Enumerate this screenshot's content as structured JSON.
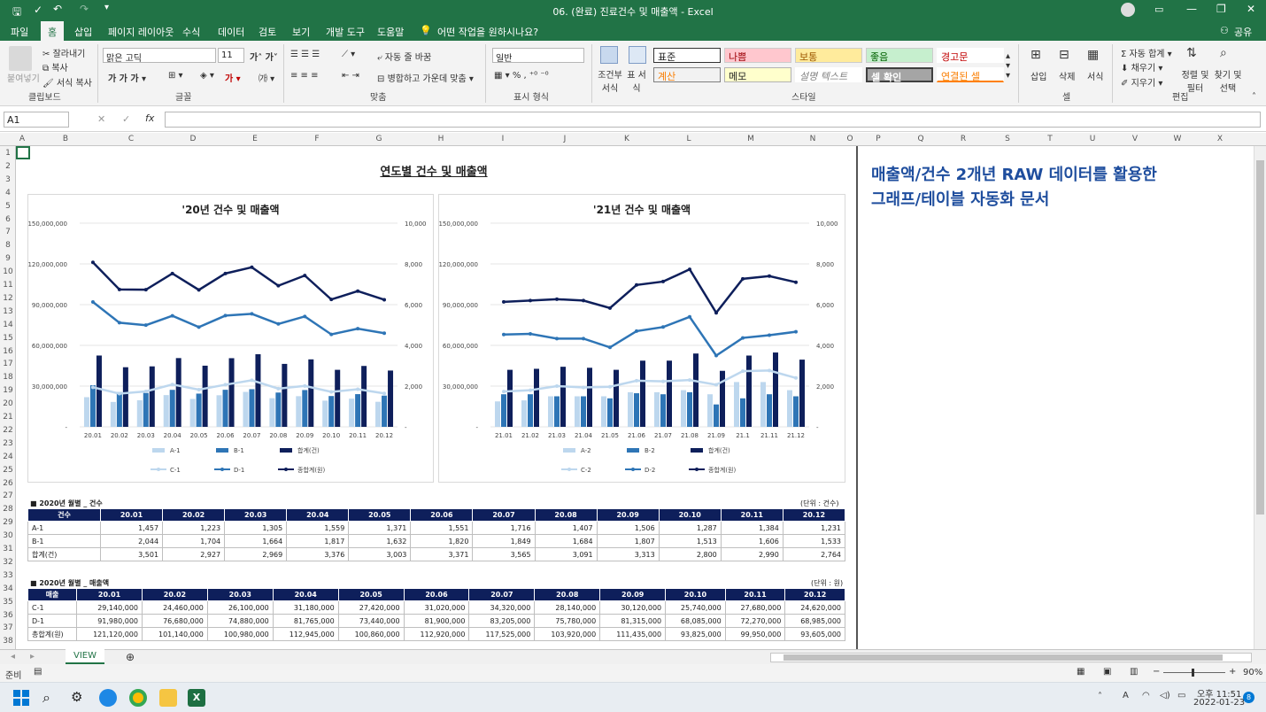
{
  "window": {
    "title": "06. (완료) 진료건수 및 매출액  -  Excel"
  },
  "menu": [
    "파일",
    "홈",
    "삽입",
    "페이지 레이아웃",
    "수식",
    "데이터",
    "검토",
    "보기",
    "개발 도구",
    "도움말"
  ],
  "menu_search": "어떤 작업을 원하시나요?",
  "share_label": "공유",
  "ribbon": {
    "paste": "붙여넣기",
    "cut": "잘라내기",
    "copy": "복사",
    "format_painter": "서식 복사",
    "clipboard": "클립보드",
    "font_name": "맑은 고딕",
    "font_size": "11",
    "font_group": "글꼴",
    "wrap_text": "자동 줄 바꿈",
    "merge_center": "병합하고 가운데 맞춤",
    "align_group": "맞춤",
    "number_format": "일반",
    "number_group": "표시 형식",
    "cond_format": "조건부 서식",
    "table_format": "표 서식",
    "styles": [
      "표준",
      "나쁨",
      "보통",
      "좋음",
      "경고문",
      "계산",
      "메모",
      "설명 텍스트",
      "셀 확인",
      "연결된 셀"
    ],
    "style_group": "스타일",
    "insert": "삽입",
    "delete": "삭제",
    "format": "서식",
    "cells_group": "셀",
    "autosum": "자동 합계",
    "fill": "채우기",
    "clear": "지우기",
    "sort_filter": "정렬 및 필터",
    "find_select": "찾기 및 선택",
    "edit_group": "편집"
  },
  "name_box": "A1",
  "columns": [
    "A",
    "B",
    "C",
    "D",
    "E",
    "F",
    "G",
    "H",
    "I",
    "J",
    "K",
    "L",
    "M",
    "N",
    "O",
    "P",
    "Q",
    "R",
    "S",
    "T",
    "U",
    "V",
    "W",
    "X"
  ],
  "rows": [
    "1",
    "2",
    "3",
    "4",
    "5",
    "6",
    "7",
    "8",
    "9",
    "10",
    "11",
    "12",
    "13",
    "14",
    "15",
    "16",
    "17",
    "18",
    "19",
    "20",
    "21",
    "22",
    "23",
    "24",
    "25",
    "26",
    "27",
    "28",
    "29",
    "30",
    "31",
    "32",
    "33",
    "34",
    "35",
    "36",
    "37",
    "38"
  ],
  "sheet": {
    "main_title": "연도별 건수 및 매출액",
    "side_title_line1": "매출액/건수 2개년 RAW 데이터를 활용한",
    "side_title_line2": "그래프/테이블 자동화 문서"
  },
  "chart_data": [
    {
      "type": "bar",
      "title": "'20년 건수 및 매출액",
      "categories": [
        "20.01",
        "20.02",
        "20.03",
        "20.04",
        "20.05",
        "20.06",
        "20.07",
        "20.08",
        "20.09",
        "20.10",
        "20.11",
        "20.12"
      ],
      "y_left_ticks": [
        "150,000,000",
        "120,000,000",
        "90,000,000",
        "60,000,000",
        "30,000,000",
        "-"
      ],
      "y_right_ticks": [
        "10,000",
        "8,000",
        "6,000",
        "4,000",
        "2,000",
        "-"
      ],
      "ylim_left": [
        0,
        150000000
      ],
      "ylim_right": [
        0,
        10000
      ],
      "series": [
        {
          "name": "A-1",
          "kind": "bar",
          "axis": "right",
          "color": "#bdd7ee",
          "values": [
            1457,
            1223,
            1305,
            1559,
            1371,
            1551,
            1716,
            1407,
            1506,
            1287,
            1384,
            1231
          ]
        },
        {
          "name": "B-1",
          "kind": "bar",
          "axis": "right",
          "color": "#2e75b6",
          "values": [
            2044,
            1704,
            1664,
            1817,
            1632,
            1820,
            1849,
            1684,
            1807,
            1513,
            1606,
            1533
          ]
        },
        {
          "name": "합계(건)",
          "kind": "bar",
          "axis": "right",
          "color": "#0e1f5b",
          "values": [
            3501,
            2927,
            2969,
            3376,
            3003,
            3371,
            3565,
            3091,
            3313,
            2800,
            2990,
            2764
          ]
        },
        {
          "name": "C-1",
          "kind": "line",
          "axis": "left",
          "color": "#bdd7ee",
          "values": [
            29140000,
            24460000,
            26100000,
            31180000,
            27420000,
            31020000,
            34320000,
            28140000,
            30120000,
            25740000,
            27680000,
            24620000
          ]
        },
        {
          "name": "D-1",
          "kind": "line",
          "axis": "left",
          "color": "#2e75b6",
          "values": [
            91980000,
            76680000,
            74880000,
            81765000,
            73440000,
            81900000,
            83205000,
            75780000,
            81315000,
            68085000,
            72270000,
            68985000
          ]
        },
        {
          "name": "종합계(원)",
          "kind": "line",
          "axis": "left",
          "color": "#0e1f5b",
          "values": [
            121120000,
            101140000,
            100980000,
            112945000,
            100860000,
            112920000,
            117525000,
            103920000,
            111435000,
            93825000,
            99950000,
            93605000
          ]
        }
      ]
    },
    {
      "type": "bar",
      "title": "'21년 건수 및 매출액",
      "categories": [
        "21.01",
        "21.02",
        "21.03",
        "21.04",
        "21.05",
        "21.06",
        "21.07",
        "21.08",
        "21.09",
        "21.1",
        "21.11",
        "21.12"
      ],
      "y_left_ticks": [
        "150,000,000",
        "120,000,000",
        "90,000,000",
        "60,000,000",
        "30,000,000",
        "-"
      ],
      "y_right_ticks": [
        "10,000",
        "8,000",
        "6,000",
        "4,000",
        "2,000",
        "-"
      ],
      "ylim_left": [
        0,
        150000000
      ],
      "ylim_right": [
        0,
        10000
      ],
      "series": [
        {
          "name": "A-2",
          "kind": "bar",
          "axis": "right",
          "color": "#bdd7ee",
          "values": [
            1250,
            1300,
            1500,
            1500,
            1500,
            1700,
            1700,
            1800,
            1600,
            2200,
            2200,
            1800
          ]
        },
        {
          "name": "B-2",
          "kind": "bar",
          "axis": "right",
          "color": "#2e75b6",
          "values": [
            1600,
            1600,
            1500,
            1500,
            1400,
            1650,
            1600,
            1700,
            1100,
            1400,
            1600,
            1500
          ]
        },
        {
          "name": "합계(건)",
          "kind": "bar",
          "axis": "right",
          "color": "#0e1f5b",
          "values": [
            2800,
            2850,
            2950,
            2900,
            2800,
            3250,
            3250,
            3600,
            2750,
            3500,
            3650,
            3300
          ]
        },
        {
          "name": "C-2",
          "kind": "line",
          "axis": "left",
          "color": "#bdd7ee",
          "values": [
            26000000,
            27000000,
            30000000,
            29000000,
            29500000,
            34000000,
            33500000,
            34500000,
            31000000,
            41000000,
            41500000,
            36000000
          ]
        },
        {
          "name": "D-2",
          "kind": "line",
          "axis": "left",
          "color": "#2e75b6",
          "values": [
            68000000,
            68500000,
            65000000,
            65000000,
            58500000,
            70500000,
            73500000,
            81000000,
            52500000,
            65500000,
            67500000,
            70000000
          ]
        },
        {
          "name": "종합계(원)",
          "kind": "line",
          "axis": "left",
          "color": "#0e1f5b",
          "values": [
            92000000,
            93000000,
            94000000,
            93000000,
            87500000,
            104500000,
            107000000,
            116000000,
            84000000,
            109000000,
            111000000,
            106500000
          ]
        }
      ]
    }
  ],
  "table1": {
    "title": "■ 2020년 월별 _ 건수",
    "unit": "(단위 : 건수)",
    "header": [
      "건수",
      "20.01",
      "20.02",
      "20.03",
      "20.04",
      "20.05",
      "20.06",
      "20.07",
      "20.08",
      "20.09",
      "20.10",
      "20.11",
      "20.12"
    ],
    "rows": [
      [
        "A-1",
        "1,457",
        "1,223",
        "1,305",
        "1,559",
        "1,371",
        "1,551",
        "1,716",
        "1,407",
        "1,506",
        "1,287",
        "1,384",
        "1,231"
      ],
      [
        "B-1",
        "2,044",
        "1,704",
        "1,664",
        "1,817",
        "1,632",
        "1,820",
        "1,849",
        "1,684",
        "1,807",
        "1,513",
        "1,606",
        "1,533"
      ],
      [
        "합계(건)",
        "3,501",
        "2,927",
        "2,969",
        "3,376",
        "3,003",
        "3,371",
        "3,565",
        "3,091",
        "3,313",
        "2,800",
        "2,990",
        "2,764"
      ]
    ]
  },
  "table2": {
    "title": "■ 2020년 월별 _ 매출액",
    "unit": "(단위 : 원)",
    "header": [
      "매출",
      "20.01",
      "20.02",
      "20.03",
      "20.04",
      "20.05",
      "20.06",
      "20.07",
      "20.08",
      "20.09",
      "20.10",
      "20.11",
      "20.12"
    ],
    "rows": [
      [
        "C-1",
        "29,140,000",
        "24,460,000",
        "26,100,000",
        "31,180,000",
        "27,420,000",
        "31,020,000",
        "34,320,000",
        "28,140,000",
        "30,120,000",
        "25,740,000",
        "27,680,000",
        "24,620,000"
      ],
      [
        "D-1",
        "91,980,000",
        "76,680,000",
        "74,880,000",
        "81,765,000",
        "73,440,000",
        "81,900,000",
        "83,205,000",
        "75,780,000",
        "81,315,000",
        "68,085,000",
        "72,270,000",
        "68,985,000"
      ],
      [
        "총합계(원)",
        "121,120,000",
        "101,140,000",
        "100,980,000",
        "112,945,000",
        "100,860,000",
        "112,920,000",
        "117,525,000",
        "103,920,000",
        "111,435,000",
        "93,825,000",
        "99,950,000",
        "93,605,000"
      ]
    ]
  },
  "sheet_tab": "VIEW",
  "status": {
    "ready": "준비",
    "zoom": "90%"
  },
  "taskbar": {
    "time": "오후 11:51",
    "date": "2022-01-23",
    "notif": "8"
  }
}
